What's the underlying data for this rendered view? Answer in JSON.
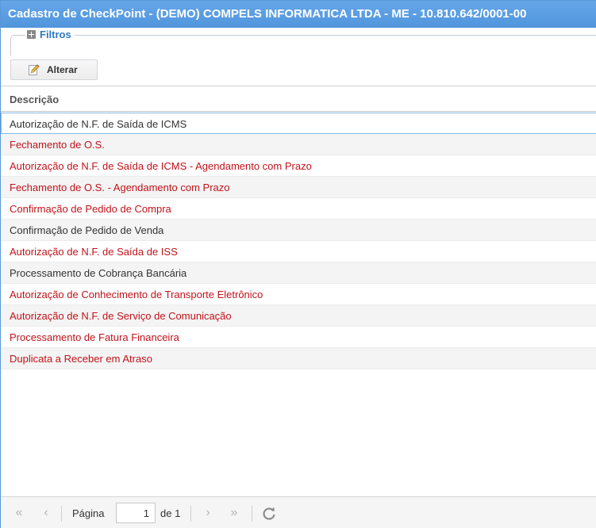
{
  "window": {
    "title": "Cadastro de CheckPoint - (DEMO) COMPELS INFORMATICA LTDA - ME - 10.810.642/0001-00"
  },
  "filters": {
    "label": "Filtros",
    "icon": "plus-icon"
  },
  "toolbar": {
    "alterar_label": "Alterar",
    "alterar_icon": "edit-pencil-icon"
  },
  "grid": {
    "columns": [
      "Descrição"
    ],
    "rows": [
      {
        "descricao": "Autorização de N.F. de Saída de ICMS",
        "color": "#333333",
        "selected": true
      },
      {
        "descricao": "Fechamento de O.S.",
        "color": "#c0131b"
      },
      {
        "descricao": "Autorização de N.F. de Saída de ICMS - Agendamento com Prazo",
        "color": "#c0131b"
      },
      {
        "descricao": "Fechamento de O.S. - Agendamento com Prazo",
        "color": "#c0131b"
      },
      {
        "descricao": "Confirmação de Pedido de Compra",
        "color": "#c0131b"
      },
      {
        "descricao": "Confirmação de Pedido de Venda",
        "color": "#333333"
      },
      {
        "descricao": "Autorização de N.F. de Saída de ISS",
        "color": "#c0131b"
      },
      {
        "descricao": "Processamento de Cobrança Bancária",
        "color": "#333333"
      },
      {
        "descricao": "Autorização de Conhecimento de Transporte Eletrônico",
        "color": "#c0131b"
      },
      {
        "descricao": "Autorização de N.F. de Serviço de Comunicação",
        "color": "#c0131b"
      },
      {
        "descricao": "Processamento de Fatura Financeira",
        "color": "#c0131b"
      },
      {
        "descricao": "Duplicata a Receber em Atraso",
        "color": "#c0131b"
      }
    ]
  },
  "pager": {
    "page_label": "Página",
    "page_value": "1",
    "of_label": "de 1",
    "icons": [
      "first-page-icon",
      "prev-page-icon",
      "next-page-icon",
      "last-page-icon",
      "refresh-icon"
    ]
  },
  "colors": {
    "title_bar": "#5195dc",
    "accent": "#2e78c6",
    "row_red": "#c0131b"
  }
}
